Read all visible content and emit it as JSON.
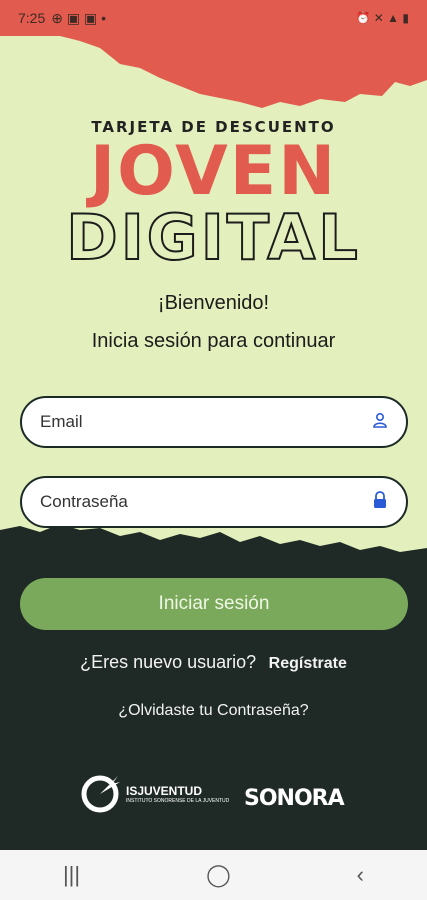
{
  "status_bar": {
    "time": "7:25",
    "left_icons": "⊕ ▣ ▣ •",
    "right_icons": "⏰ ✕ ▲ ▮"
  },
  "brand": {
    "subtitle": "TARJETA DE DESCUENTO",
    "title_line1": "JOVEN",
    "title_line2": "DIGITAL"
  },
  "welcome": "¡Bienvenido!",
  "instruction": "Inicia sesión para continuar",
  "email": {
    "placeholder": "Email",
    "icon": "user-icon"
  },
  "password": {
    "placeholder": "Contraseña",
    "icon": "lock-icon"
  },
  "login_button": "Iniciar sesión",
  "register": {
    "question": "¿Eres nuevo usuario?",
    "link": "Regístrate"
  },
  "forgot_password": "¿Olvidaste tu Contraseña?",
  "logos": {
    "isj_name": "ISJUVENTUD",
    "isj_small": "INSTITUTO SONORENSE DE LA JUVENTUD",
    "sonora": "SONORA"
  },
  "nav": {
    "recents": "|||",
    "home": "◯",
    "back": "‹"
  },
  "colors": {
    "accent_red": "#e15b4e",
    "bg_light": "#e3efbc",
    "dark": "#1f2a26",
    "button_green": "#7aa95c",
    "icon_blue": "#2a5bd7"
  }
}
